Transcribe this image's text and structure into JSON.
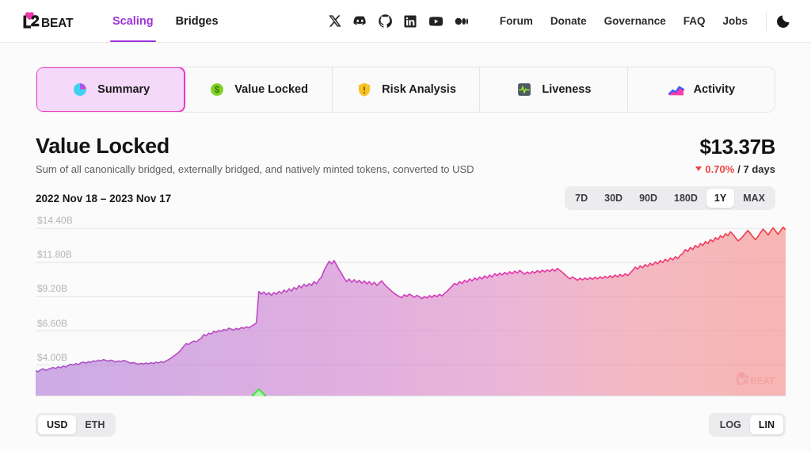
{
  "header": {
    "logo_text": "L2BEAT",
    "main_nav": [
      {
        "label": "Scaling",
        "active": true
      },
      {
        "label": "Bridges",
        "active": false
      }
    ],
    "socials": [
      {
        "name": "x-twitter-icon"
      },
      {
        "name": "discord-icon"
      },
      {
        "name": "github-icon"
      },
      {
        "name": "linkedin-icon"
      },
      {
        "name": "youtube-icon"
      },
      {
        "name": "video-icon"
      }
    ],
    "right_nav": [
      {
        "label": "Forum"
      },
      {
        "label": "Donate"
      },
      {
        "label": "Governance"
      },
      {
        "label": "FAQ"
      },
      {
        "label": "Jobs"
      }
    ],
    "theme_toggle": "moon-icon"
  },
  "tabs": [
    {
      "label": "Summary",
      "icon": "pie-chart-icon",
      "active": true
    },
    {
      "label": "Value Locked",
      "icon": "dollar-circle-icon",
      "active": false
    },
    {
      "label": "Risk Analysis",
      "icon": "shield-warning-icon",
      "active": false
    },
    {
      "label": "Liveness",
      "icon": "heartbeat-icon",
      "active": false
    },
    {
      "label": "Activity",
      "icon": "area-chart-icon",
      "active": false
    }
  ],
  "main": {
    "title": "Value Locked",
    "subtitle": "Sum of all canonically bridged, externally bridged, and natively minted tokens, converted to USD",
    "value": "$13.37B",
    "change_pct": "0.70%",
    "change_period": "/ 7 days",
    "change_direction": "down",
    "date_range": "2022 Nov 18 – 2023 Nov 17"
  },
  "range_selector": {
    "options": [
      "7D",
      "30D",
      "90D",
      "180D",
      "1Y",
      "MAX"
    ],
    "selected": "1Y"
  },
  "currency_toggle": {
    "options": [
      "USD",
      "ETH"
    ],
    "selected": "USD"
  },
  "scale_toggle": {
    "options": [
      "LOG",
      "LIN"
    ],
    "selected": "LIN"
  },
  "colors": {
    "accent_purple": "#9b35d9",
    "accent_pink": "#e838c6",
    "negative_red": "#ef4444",
    "line_start": "#a855cc",
    "line_mid": "#e033b0",
    "line_end": "#f23b3b",
    "marker_green": "#4ade4a"
  },
  "chart_data": {
    "type": "area",
    "title": "Value Locked",
    "xlabel": "",
    "ylabel": "USD",
    "ylim": [
      1600000000,
      15200000000
    ],
    "grid": true,
    "legend": false,
    "y_ticks": [
      {
        "label": "$14.40B",
        "value": 14400000000
      },
      {
        "label": "$11.80B",
        "value": 11800000000
      },
      {
        "label": "$9.20B",
        "value": 9200000000
      },
      {
        "label": "$6.60B",
        "value": 6600000000
      },
      {
        "label": "$4.00B",
        "value": 4000000000
      }
    ],
    "x_start": "2022 Nov 18",
    "x_end": "2023 Nov 17",
    "marker": {
      "label": "milestone",
      "x_index": 89,
      "color": "#4ade4a",
      "shape": "diamond"
    },
    "series": [
      {
        "name": "Value Locked",
        "units": "USD",
        "values": [
          3.55,
          3.48,
          3.62,
          3.7,
          3.58,
          3.66,
          3.74,
          3.8,
          3.72,
          3.86,
          3.78,
          3.9,
          3.84,
          3.95,
          4.05,
          3.98,
          4.1,
          4.02,
          4.14,
          4.22,
          4.12,
          4.24,
          4.18,
          4.3,
          4.26,
          4.36,
          4.3,
          4.4,
          4.34,
          4.28,
          4.36,
          4.3,
          4.22,
          4.3,
          4.24,
          4.34,
          4.28,
          4.2,
          4.12,
          4.18,
          4.1,
          4.04,
          4.12,
          4.06,
          4.14,
          4.08,
          4.16,
          4.1,
          4.2,
          4.14,
          4.24,
          4.18,
          4.3,
          4.4,
          4.52,
          4.66,
          4.8,
          4.95,
          5.15,
          5.4,
          5.62,
          5.55,
          5.7,
          5.82,
          5.75,
          5.9,
          6.02,
          6.3,
          6.22,
          6.42,
          6.35,
          6.55,
          6.48,
          6.62,
          6.55,
          6.7,
          6.62,
          6.8,
          6.72,
          6.65,
          6.78,
          6.7,
          6.85,
          6.78,
          6.9,
          6.82,
          6.95,
          7.05,
          7.2,
          9.6,
          9.4,
          9.55,
          9.35,
          9.5,
          9.3,
          9.52,
          9.38,
          9.6,
          9.45,
          9.7,
          9.55,
          9.8,
          9.62,
          9.9,
          9.75,
          10.05,
          9.88,
          10.15,
          9.98,
          10.2,
          10.05,
          10.35,
          10.18,
          10.5,
          10.7,
          11.2,
          11.55,
          11.9,
          11.7,
          11.95,
          11.6,
          11.25,
          10.95,
          10.6,
          10.35,
          10.55,
          10.3,
          10.5,
          10.28,
          10.45,
          10.22,
          10.4,
          10.18,
          10.35,
          10.12,
          10.3,
          10.05,
          10.25,
          10.4,
          10.15,
          9.95,
          9.78,
          9.6,
          9.45,
          9.32,
          9.2,
          9.12,
          9.35,
          9.22,
          9.4,
          9.28,
          9.15,
          9.3,
          9.18,
          9.05,
          9.2,
          9.1,
          9.28,
          9.15,
          9.32,
          9.2,
          9.38,
          9.25,
          9.45,
          9.6,
          9.8,
          10.0,
          10.2,
          10.1,
          10.35,
          10.2,
          10.45,
          10.3,
          10.55,
          10.4,
          10.62,
          10.48,
          10.7,
          10.55,
          10.78,
          10.62,
          10.85,
          10.7,
          10.95,
          10.8,
          11.0,
          10.85,
          11.05,
          10.9,
          11.1,
          10.95,
          11.15,
          11.0,
          11.2,
          11.05,
          10.92,
          11.08,
          10.95,
          11.12,
          11.0,
          11.18,
          11.05,
          11.22,
          11.08,
          11.25,
          11.12,
          11.3,
          11.15,
          11.35,
          11.2,
          11.05,
          10.88,
          10.7,
          10.55,
          10.7,
          10.58,
          10.45,
          10.6,
          10.48,
          10.62,
          10.5,
          10.65,
          10.52,
          10.68,
          10.55,
          10.72,
          10.58,
          10.75,
          10.62,
          10.8,
          10.65,
          10.85,
          10.7,
          10.9,
          10.75,
          10.95,
          10.8,
          11.0,
          11.2,
          11.45,
          11.3,
          11.55,
          11.4,
          11.65,
          11.5,
          11.75,
          11.6,
          11.85,
          11.7,
          11.95,
          11.8,
          12.05,
          11.9,
          12.15,
          12.0,
          12.25,
          12.1,
          12.35,
          12.5,
          12.8,
          12.65,
          12.95,
          12.8,
          13.1,
          12.95,
          13.25,
          13.1,
          13.4,
          13.25,
          13.55,
          13.4,
          13.7,
          13.55,
          13.85,
          13.7,
          14.0,
          13.85,
          14.15,
          13.95,
          13.7,
          13.45,
          13.6,
          13.8,
          14.05,
          14.25,
          14.0,
          13.75,
          13.55,
          13.8,
          14.1,
          14.35,
          14.15,
          13.9,
          14.2,
          14.45,
          14.2,
          13.95,
          14.25,
          14.5,
          14.3
        ]
      }
    ]
  }
}
